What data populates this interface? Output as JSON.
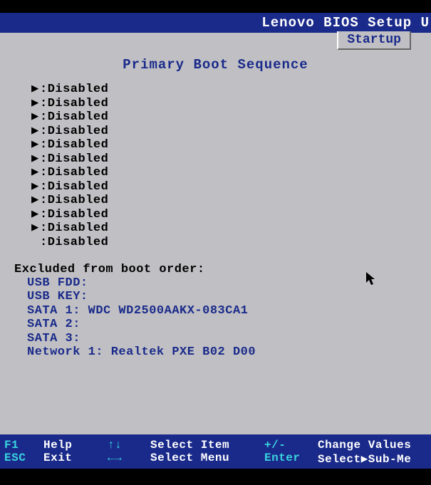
{
  "title": "Lenovo BIOS Setup U",
  "tab": "Startup",
  "section_title": "Primary Boot Sequence",
  "boot_items": [
    {
      "arrow": "▶",
      "label": ":Disabled"
    },
    {
      "arrow": "▶",
      "label": ":Disabled"
    },
    {
      "arrow": "▶",
      "label": ":Disabled"
    },
    {
      "arrow": "▶",
      "label": ":Disabled"
    },
    {
      "arrow": "▶",
      "label": ":Disabled"
    },
    {
      "arrow": "▶",
      "label": ":Disabled"
    },
    {
      "arrow": "▶",
      "label": ":Disabled"
    },
    {
      "arrow": "▶",
      "label": ":Disabled"
    },
    {
      "arrow": "▶",
      "label": ":Disabled"
    },
    {
      "arrow": "▶",
      "label": ":Disabled"
    },
    {
      "arrow": "▶",
      "label": ":Disabled"
    },
    {
      "arrow": " ",
      "label": ":Disabled"
    }
  ],
  "excluded_header": "Excluded from boot order:",
  "excluded_items": [
    "USB FDD:",
    "USB KEY:",
    "SATA 1: WDC WD2500AAKX-083CA1",
    "SATA 2:",
    "SATA 3:",
    "Network 1: Realtek PXE B02 D00"
  ],
  "footer": {
    "col1": {
      "key1": "F1",
      "key2": "ESC"
    },
    "col2": {
      "label1": "Help",
      "label2": "Exit"
    },
    "col3": {
      "key1": "↑↓",
      "key2": "←→"
    },
    "col4": {
      "label1": "Select Item",
      "label2": "Select Menu"
    },
    "col5": {
      "key1": "+/-",
      "key2": "Enter"
    },
    "col6": {
      "label1": "Change Values",
      "label2": "Select▶Sub-Me"
    }
  }
}
